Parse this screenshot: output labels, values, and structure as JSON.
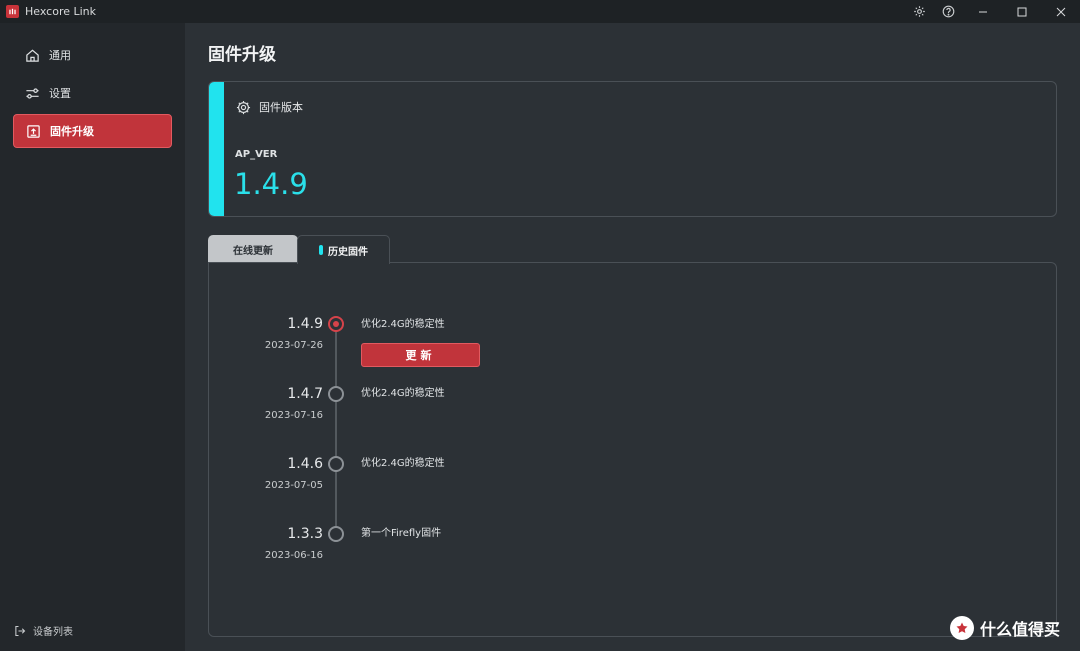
{
  "window": {
    "title": "Hexcore Link"
  },
  "sidebar": {
    "items": [
      {
        "label": "通用",
        "icon": "home-icon",
        "active": false
      },
      {
        "label": "设置",
        "icon": "settings-sliders-icon",
        "active": false
      },
      {
        "label": "固件升级",
        "icon": "firmware-upload-icon",
        "active": true
      }
    ],
    "device_list_label": "设备列表"
  },
  "main": {
    "title": "固件升级",
    "firmware_card": {
      "header": "固件版本",
      "label": "AP_VER",
      "version": "1.4.9",
      "accent_color": "#21e3ee"
    },
    "tabs": [
      {
        "label": "在线更新",
        "active": false
      },
      {
        "label": "历史固件",
        "active": true
      }
    ],
    "history": [
      {
        "version": "1.4.9",
        "date": "2023-07-26",
        "description": "优化2.4G的稳定性",
        "current": true
      },
      {
        "version": "1.4.7",
        "date": "2023-07-16",
        "description": "优化2.4G的稳定性",
        "current": false
      },
      {
        "version": "1.4.6",
        "date": "2023-07-05",
        "description": "优化2.4G的稳定性",
        "current": false
      },
      {
        "version": "1.3.3",
        "date": "2023-06-16",
        "description": "第一个Firefly固件",
        "current": false
      }
    ],
    "update_button_label": "更新"
  },
  "watermark": {
    "text": "什么值得买"
  },
  "colors": {
    "accent_red": "#c1343b",
    "accent_cyan": "#21e3ee"
  }
}
